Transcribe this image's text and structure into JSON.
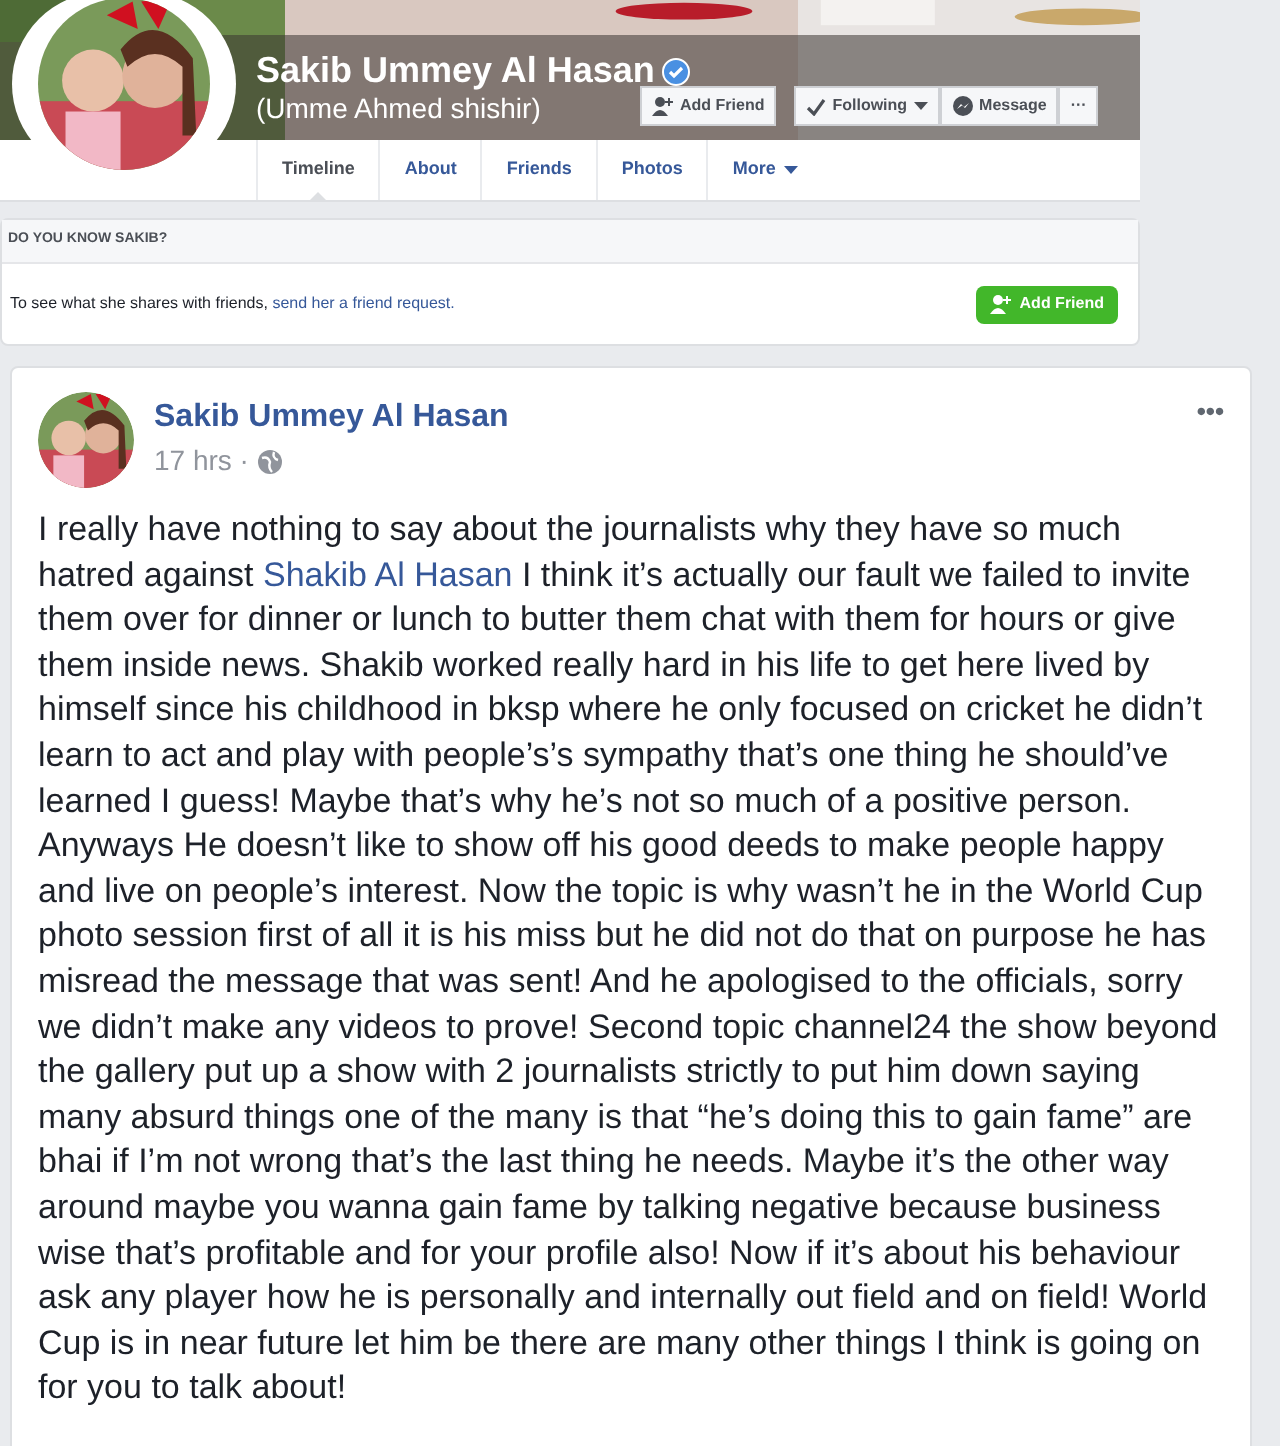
{
  "profile": {
    "name": "Sakib Ummey Al Hasan",
    "verified": true,
    "alternate_name": "(Umme Ahmed shishir)",
    "buttons": [
      {
        "kind": "add",
        "label": "Add Friend"
      },
      {
        "kind": "following",
        "label": "Following"
      },
      {
        "kind": "message",
        "label": "Message"
      },
      {
        "kind": "more",
        "label": "···"
      }
    ]
  },
  "tabs": [
    {
      "label": "Timeline",
      "selected": true,
      "dropdown": false
    },
    {
      "label": "About",
      "selected": false,
      "dropdown": false
    },
    {
      "label": "Friends",
      "selected": false,
      "dropdown": false
    },
    {
      "label": "Photos",
      "selected": false,
      "dropdown": false
    },
    {
      "label": "More",
      "selected": false,
      "dropdown": true
    }
  ],
  "know_box": {
    "heading": "DO YOU KNOW SAKIB?",
    "text": "To see what she shares with friends,",
    "link": "send her a friend request.",
    "button": "Add Friend"
  },
  "post": {
    "author": "Sakib Ummey Al Hasan",
    "time": "17 hrs ·",
    "menu": "•••",
    "body_before": "I really have nothing to say about the journalists why they have so much hatred against",
    "body_link": "Shakib Al Hasan",
    "body_after": "I think it’s actually our fault we failed to invite them over for dinner or lunch to butter them chat with them for hours or give them inside news. Shakib worked really hard in his life to get here lived by himself since his childhood in bksp where he only focused on cricket he didn’t learn to act and play with people’s’s sympathy that’s one thing he should’ve learned I guess! Maybe that’s why he’s not so much of a positive person. Anyways He doesn’t like to show off his good deeds to make people happy and live on people’s interest. Now the topic is why wasn’t he in the World Cup photo session first of all it is his miss but he did not do that on purpose he has misread the message that was sent! And he apologised to the officials, sorry we didn’t make any videos to prove! Second topic channel24 the show beyond the gallery put up a show with 2 journalists strictly to put him down saying many absurd things one of the many is that “he’s doing this to gain fame” are bhai if I’m not wrong that’s the last thing he needs. Maybe it’s the other way around maybe you wanna gain fame by talking negative because business wise that’s profitable and for your profile also! Now if it’s about his behaviour ask any player how he is personally and internally out field and on field! World Cup is in near future let him be there are many other things I think is going on for you to talk about!"
  }
}
